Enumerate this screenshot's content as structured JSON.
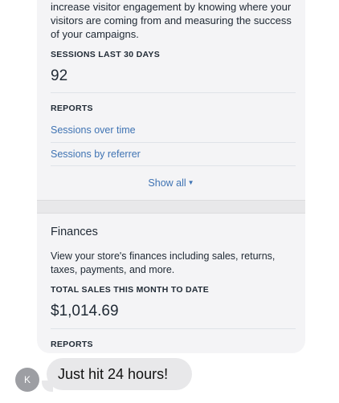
{
  "marketing": {
    "intro": "increase visitor engagement by knowing where your visitors are coming from and measuring the success of your campaigns.",
    "sessions_label": "SESSIONS LAST 30 DAYS",
    "sessions_value": "92",
    "reports_label": "REPORTS",
    "reports": [
      "Sessions over time",
      "Sessions by referrer"
    ],
    "show_all": "Show all"
  },
  "finances": {
    "title": "Finances",
    "description": "View your store's finances including sales, returns, taxes, payments, and more.",
    "total_label": "TOTAL SALES THIS MONTH TO DATE",
    "total_value": "$1,014.69",
    "reports_label": "REPORTS"
  },
  "message": {
    "avatar_initial": "K",
    "text": "Just hit 24 hours!"
  }
}
